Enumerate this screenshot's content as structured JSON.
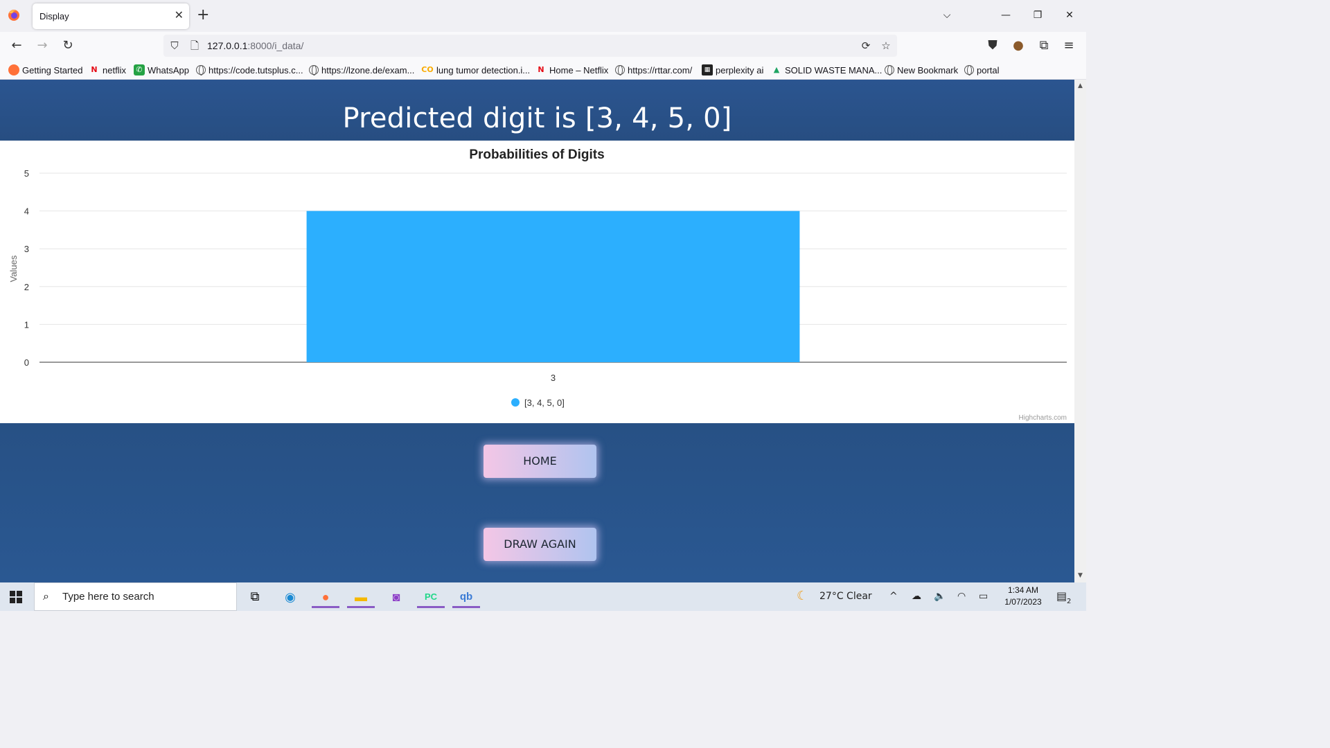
{
  "browser": {
    "tab_title": "Display",
    "tab_close": "✕",
    "new_tab": "+",
    "url_host": "127.0.0.1",
    "url_rest": ":8000/i_data/",
    "bookmarks": [
      {
        "label": "Getting Started",
        "icon": "firefox-icon"
      },
      {
        "label": "netflix",
        "icon": "netflix-icon"
      },
      {
        "label": "WhatsApp",
        "icon": "whatsapp-icon"
      },
      {
        "label": "https://code.tutsplus.c...",
        "icon": "globe-icon"
      },
      {
        "label": "https://lzone.de/exam...",
        "icon": "globe-icon"
      },
      {
        "label": "lung tumor detection.i...",
        "icon": "colab-icon"
      },
      {
        "label": "Home – Netflix",
        "icon": "netflix-icon"
      },
      {
        "label": "https://rttar.com/",
        "icon": "globe-icon"
      },
      {
        "label": "perplexity ai",
        "icon": "grid-icon"
      },
      {
        "label": "SOLID WASTE MANA...",
        "icon": "drive-icon"
      },
      {
        "label": "New Bookmark",
        "icon": "globe-icon"
      },
      {
        "label": "portal",
        "icon": "globe-icon"
      }
    ]
  },
  "page": {
    "heading": "Predicted digit is [3, 4, 5, 0]",
    "home_button": "HOME",
    "draw_again_button": "DRAW AGAIN",
    "credits": "Highcharts.com"
  },
  "chart_data": {
    "type": "bar",
    "title": "Probabilities of Digits",
    "ylabel": "Values",
    "xlabel": "",
    "categories": [
      "3"
    ],
    "series": [
      {
        "name": "[3, 4, 5, 0]",
        "values": [
          4
        ]
      }
    ],
    "ylim": [
      0,
      5
    ],
    "yticks": [
      0,
      1,
      2,
      3,
      4,
      5
    ],
    "grid": true,
    "legend": "bottom-center",
    "colors": {
      "bar": "#2caffe"
    }
  },
  "taskbar": {
    "search_placeholder": "Type here to search",
    "weather": "27°C  Clear",
    "time": "1:34 AM",
    "date": "1/07/2023",
    "notification_count": "2"
  }
}
